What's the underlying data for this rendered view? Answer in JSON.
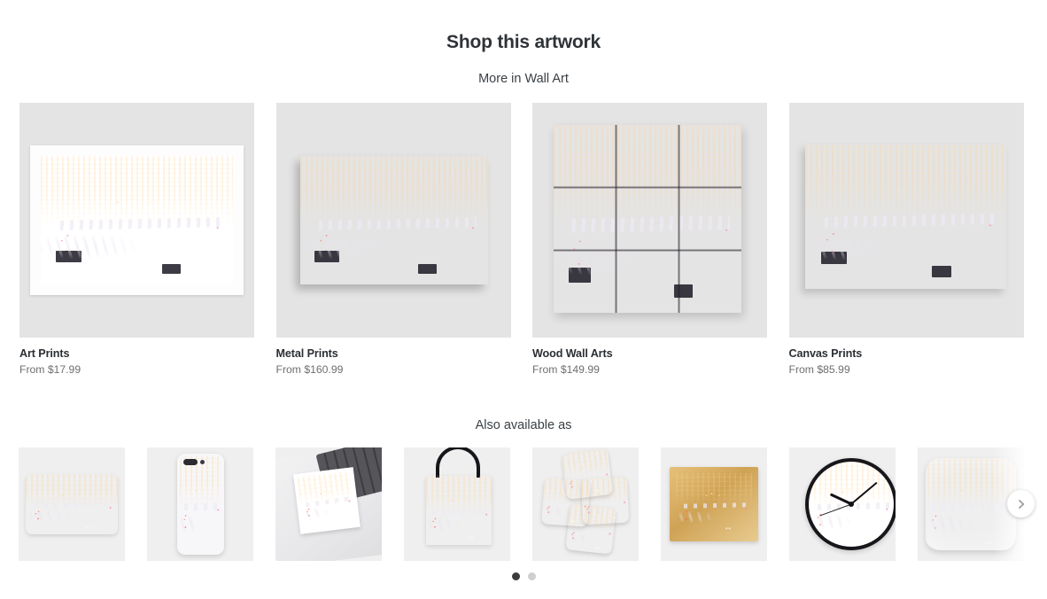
{
  "header": {
    "title": "Shop this artwork",
    "subtitle": "More in Wall Art",
    "also_available_label": "Also available as"
  },
  "products": [
    {
      "name": "Art Prints",
      "price": "From $17.99",
      "mockup": "framed-art-print"
    },
    {
      "name": "Metal Prints",
      "price": "From $160.99",
      "mockup": "metal-print-panel"
    },
    {
      "name": "Wood Wall Arts",
      "price": "From $149.99",
      "mockup": "wood-wall-art-3x3"
    },
    {
      "name": "Canvas Prints",
      "price": "From $85.99",
      "mockup": "canvas-print"
    }
  ],
  "also_available": [
    {
      "product": "bath-mat"
    },
    {
      "product": "iphone-case"
    },
    {
      "product": "sticker"
    },
    {
      "product": "tote-bag"
    },
    {
      "product": "coasters"
    },
    {
      "product": "serving-tray"
    },
    {
      "product": "wall-clock"
    },
    {
      "product": "throw-pillow"
    }
  ],
  "carousel": {
    "next_icon": "chevron-right-icon",
    "dots": [
      {
        "active": true
      },
      {
        "active": false
      }
    ]
  },
  "colors": {
    "page_background": "#ffffff",
    "card_background": "#e4e4e4",
    "tile_background": "#efefef",
    "heading_text": "#2f3337",
    "price_text": "#6d6f72",
    "dot_active": "#3c3c3c",
    "dot_inactive": "#cfcfcf",
    "artwork_accent_pink": "#e8406a",
    "artwork_accent_teal": "#3cdcd7",
    "artwork_accent_purple": "#c47ece"
  }
}
